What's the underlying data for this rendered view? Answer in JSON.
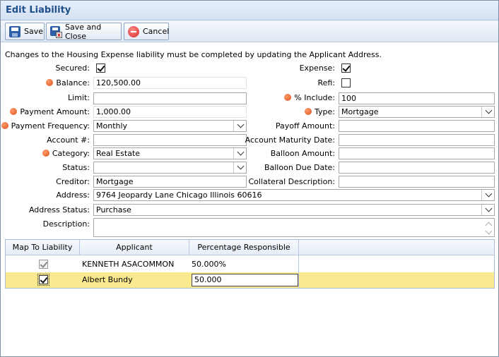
{
  "window": {
    "title": "Edit Liability"
  },
  "toolbar": {
    "save": "Save",
    "save_close": "Save and Close",
    "cancel": "Cancel"
  },
  "notice": "Changes to the Housing Expense liability must be completed by updating the Applicant Address.",
  "form": {
    "secured": {
      "label": "Secured:",
      "checked": true
    },
    "expense": {
      "label": "Expense:",
      "checked": true
    },
    "balance": {
      "label": "Balance:",
      "value": "120,500.00"
    },
    "refi": {
      "label": "Refi:",
      "checked": false
    },
    "limit": {
      "label": "Limit:",
      "value": ""
    },
    "pct_include": {
      "label": "% Include:",
      "value": "100"
    },
    "payment_amount": {
      "label": "Payment Amount:",
      "value": "1,000.00"
    },
    "type": {
      "label": "Type:",
      "value": "Mortgage"
    },
    "payment_frequency": {
      "label": "Payment Frequency:",
      "value": "Monthly"
    },
    "payoff_amount": {
      "label": "Payoff Amount:",
      "value": ""
    },
    "account_no": {
      "label": "Account #:",
      "value": ""
    },
    "account_maturity_date": {
      "label": "Account Maturity Date:",
      "value": ""
    },
    "category": {
      "label": "Category:",
      "value": "Real Estate"
    },
    "balloon_amount": {
      "label": "Balloon Amount:",
      "value": ""
    },
    "status": {
      "label": "Status:",
      "value": ""
    },
    "balloon_due_date": {
      "label": "Balloon Due Date:",
      "value": ""
    },
    "creditor": {
      "label": "Creditor:",
      "value": "Mortgage"
    },
    "collateral_description": {
      "label": "Collateral Description:",
      "value": ""
    },
    "address": {
      "label": "Address:",
      "value": "9764 Jeopardy Lane Chicago Illinois 60616"
    },
    "address_status": {
      "label": "Address Status:",
      "value": "Purchase"
    },
    "description": {
      "label": "Description:",
      "value": ""
    }
  },
  "grid": {
    "headers": [
      "Map To Liability",
      "Applicant",
      "Percentage Responsible"
    ],
    "rows": [
      {
        "mapped": true,
        "applicant": "KENNETH ASACOMMON",
        "percentage": "50.000%"
      },
      {
        "mapped": true,
        "applicant": "Albert Bundy",
        "percentage": "50.000"
      }
    ]
  },
  "colors": {
    "title": "#1f4e8c",
    "required_dot": "#d9531e",
    "selected_row": "#fbe98f"
  }
}
